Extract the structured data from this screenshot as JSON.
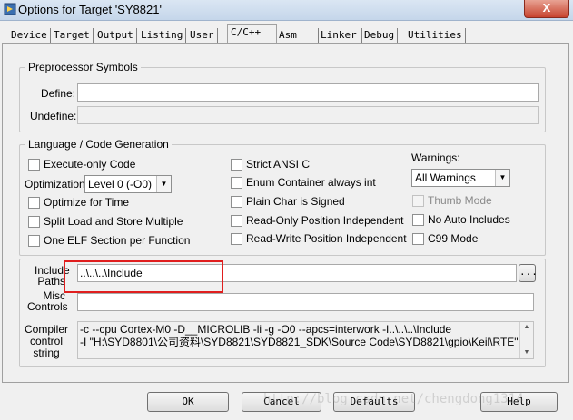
{
  "window": {
    "title": "Options for Target 'SY8821'",
    "close": "X"
  },
  "tabs": [
    "Device",
    "Target",
    "Output",
    "Listing",
    "User",
    "C/C++",
    "Asm",
    "Linker",
    "Debug",
    "Utilities"
  ],
  "preprocessor": {
    "legend": "Preprocessor Symbols",
    "define_label": "Define:",
    "define_value": "",
    "undefine_label": "Undefine:",
    "undefine_value": ""
  },
  "language": {
    "legend": "Language / Code Generation",
    "execute_only": "Execute-only Code",
    "optimization_label": "Optimization:",
    "optimization_value": "Level 0 (-O0)",
    "optimize_time": "Optimize for Time",
    "split_load": "Split Load and Store Multiple",
    "one_elf": "One ELF Section per Function",
    "strict_ansi": "Strict ANSI C",
    "enum_container": "Enum Container always int",
    "plain_char": "Plain Char is Signed",
    "ro_pos": "Read-Only Position Independent",
    "rw_pos": "Read-Write Position Independent",
    "warnings_label": "Warnings:",
    "warnings_value": "All Warnings",
    "thumb_mode": "Thumb Mode",
    "no_auto_includes": "No Auto Includes",
    "c99_mode": "C99 Mode"
  },
  "include": {
    "label_line1": "Include",
    "label_line2": "Paths",
    "value": "..\\..\\..\\Include",
    "browse": "..."
  },
  "misc": {
    "label_line1": "Misc",
    "label_line2": "Controls",
    "value": ""
  },
  "compiler": {
    "label_line1": "Compiler",
    "label_line2": "control",
    "label_line3": "string",
    "line1": "-c --cpu Cortex-M0 -D__MICROLIB -li -g -O0 --apcs=interwork -I..\\..\\..\\Include",
    "line2": "-I \"H:\\SYD8801\\公司资料\\SYD8821\\SYD8821_SDK\\Source Code\\SYD8821\\gpio\\Keil\\RTE\""
  },
  "buttons": {
    "ok": "OK",
    "cancel": "Cancel",
    "defaults": "Defaults",
    "help": "Help"
  },
  "watermark": "http://blog.csdn.net/chengdong1314"
}
